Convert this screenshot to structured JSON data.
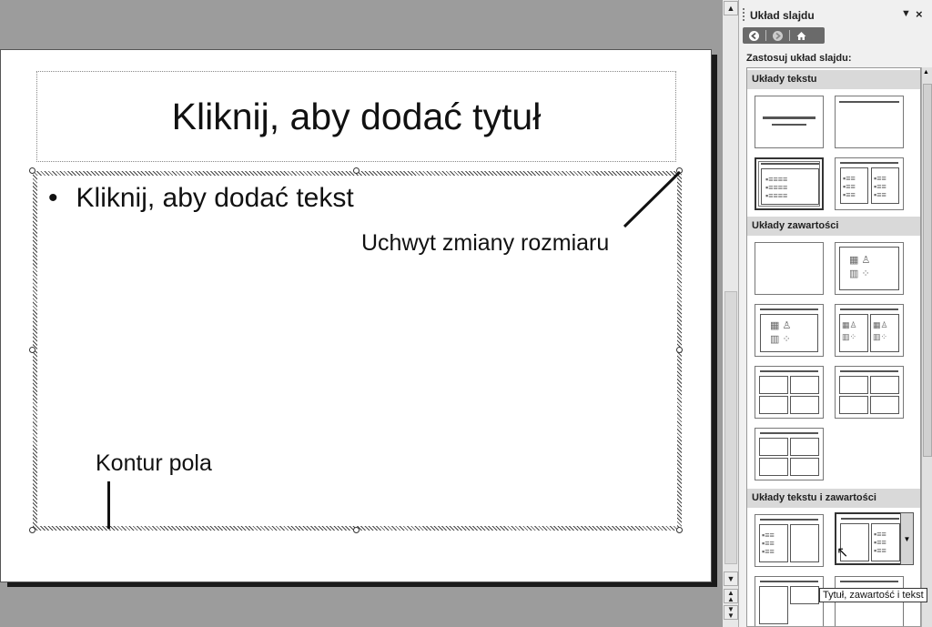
{
  "slide": {
    "title_placeholder": "Kliknij, aby dodać tytuł",
    "bullet": "•",
    "body_placeholder": "Kliknij, aby dodać tekst"
  },
  "annotations": {
    "resize_handle": "Uchwyt zmiany rozmiaru",
    "box_outline": "Kontur pola"
  },
  "task_pane": {
    "title": "Układ slajdu",
    "subtitle": "Zastosuj układ slajdu:",
    "categories": [
      "Układy tekstu",
      "Układy zawartości",
      "Układy tekstu i zawartości"
    ],
    "tooltip": "Tytuł, zawartość i tekst",
    "close_glyph": "×",
    "dropdown_glyph": "▼"
  },
  "icons": {
    "back": "back-arrow-icon",
    "forward": "forward-arrow-icon",
    "home": "home-icon"
  }
}
